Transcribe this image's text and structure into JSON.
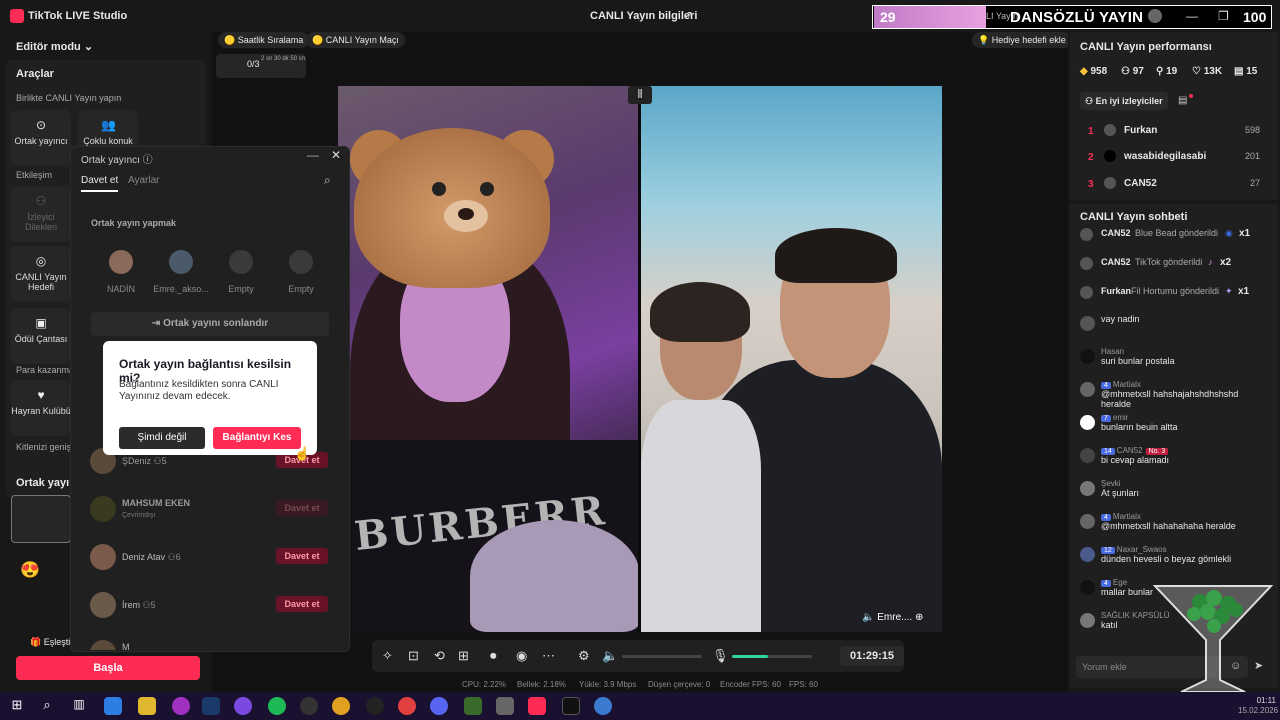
{
  "titlebar": {
    "app_title": "TikTok LIVE Studio",
    "window_title": "CANLI Yayın bilgileri"
  },
  "overlay": {
    "left_number": "29",
    "title": "DANSÖZLÜ YAYIN",
    "ghost_text": "LI Yayın",
    "right_number": "100"
  },
  "left": {
    "editor_mode": "Editör modu",
    "tools_header": "Araçlar",
    "together_label": "Birlikte CANLI Yayın yapın",
    "tool_cohost": "Ortak yayıncı",
    "tool_multi": "Çoklu konuk",
    "interaction_label": "Etkileşim",
    "tool_viewer_wishes": "İzleyici Dilekleri",
    "tool_live_goal": "CANLI Yayın Hedefi",
    "tool_reward": "Ödül Çantası",
    "earn_label": "Para kazanma",
    "tool_fanclub": "Hayran Kulübü",
    "grow_label": "Kitlenizi genişletin",
    "cohost_section": "Ortak yayıncı",
    "match_label": "Eşleştir",
    "start_button": "Başla"
  },
  "chips": {
    "hourly": "Saatlik Sıralama",
    "match": "CANLI Yayın Maçı",
    "gift_goal": "Hediye hedefi ekle",
    "counter": "0/3",
    "counter_time": "2 sn 30 dk 50 sn"
  },
  "cohost_dialog": {
    "title": "Ortak yayıncı",
    "tab_invite": "Davet et",
    "tab_settings": "Ayarlar",
    "section": "Ortak yayın yapmak",
    "slots": [
      "NADİN",
      "Emre._akso...",
      "Empty",
      "Empty"
    ],
    "end_button": "Ortak yayını sonlandır",
    "invite_rows": [
      {
        "name": "ŞDeniz",
        "count": "5",
        "button": "Davet et"
      },
      {
        "name": "MAHSUM EKEN",
        "sub": "Çevrimdışı",
        "button": "Davet et"
      },
      {
        "name": "Deniz Atav",
        "count": "6",
        "button": "Davet et"
      },
      {
        "name": "İrem",
        "count": "5",
        "button": "Davet et"
      },
      {
        "name": "M",
        "count": "",
        "button": "Davet et"
      }
    ]
  },
  "confirm": {
    "title": "Ortak yayın bağlantısı kesilsin mi?",
    "body": "Bağlantınız kesildikten sonra CANLI Yayınınız devam edecek.",
    "cancel": "Şimdi değil",
    "ok": "Bağlantıyı Kes"
  },
  "video": {
    "right_label": "Emre....",
    "shirt_text": "BURBERR"
  },
  "controls": {
    "time": "01:29:15",
    "volume_level": 0.0,
    "mic_level": 0.45
  },
  "stats": {
    "cpu": "CPU: 2.22%",
    "memory": "Bellek: 2.18%",
    "upload": "Yükle: 3.9 Mbps",
    "dropped": "Düşen çerçeve: 0",
    "encoder_fps": "Encoder FPS: 60",
    "fps": "FPS: 60"
  },
  "performance": {
    "title": "CANLI Yayın performansı",
    "diamonds": "958",
    "viewers": "97",
    "new_followers": "19",
    "likes": "13K",
    "gifters": "15",
    "top_viewers_label": "En iyi izleyiciler",
    "ranks": [
      {
        "rank": "1",
        "name": "Furkan",
        "score": "598"
      },
      {
        "rank": "2",
        "name": "wasabidegilasabi",
        "score": "201"
      },
      {
        "rank": "3",
        "name": "CAN52",
        "score": "27"
      }
    ]
  },
  "chat": {
    "title": "CANLI Yayın sohbeti",
    "gifts": [
      {
        "name": "CAN52",
        "text": "Blue Bead gönderildi",
        "count": "x1"
      },
      {
        "name": "CAN52",
        "text": "TikTok gönderildi",
        "count": "x2"
      },
      {
        "name": "Furkan",
        "text": "Fil Hortumu gönderildi",
        "count": "x1"
      }
    ],
    "messages": [
      {
        "name": "",
        "level": "",
        "text": "vay nadin"
      },
      {
        "name": "Hasan",
        "level": "",
        "text": "suri bunlar postala"
      },
      {
        "name": "Martialx",
        "level": "4",
        "text": "@mhmetxsll hahshajahshdhshshd heralde"
      },
      {
        "name": "emir",
        "level": "7",
        "text": "bunların beuin altta"
      },
      {
        "name": "CAN52",
        "level": "14",
        "badge": "No. 3",
        "text": "bi cevap alamadı"
      },
      {
        "name": "Şevki",
        "level": "",
        "text": "At şunları"
      },
      {
        "name": "Martialx",
        "level": "4",
        "text": "@mhmetxsll hahahahaha heralde"
      },
      {
        "name": "Naxar_Swaos",
        "level": "12",
        "text": "dünden hevesli o beyaz gömlekli"
      },
      {
        "name": "Ege",
        "level": "4",
        "text": "mallar bunlar"
      },
      {
        "name": "SAĞLIK KAPSÜLÜ",
        "level": "",
        "text": "katıl"
      }
    ],
    "input_placeholder": "Yorum ekle"
  },
  "taskbar": {
    "time": "01:11",
    "date": "15.02.2026"
  }
}
